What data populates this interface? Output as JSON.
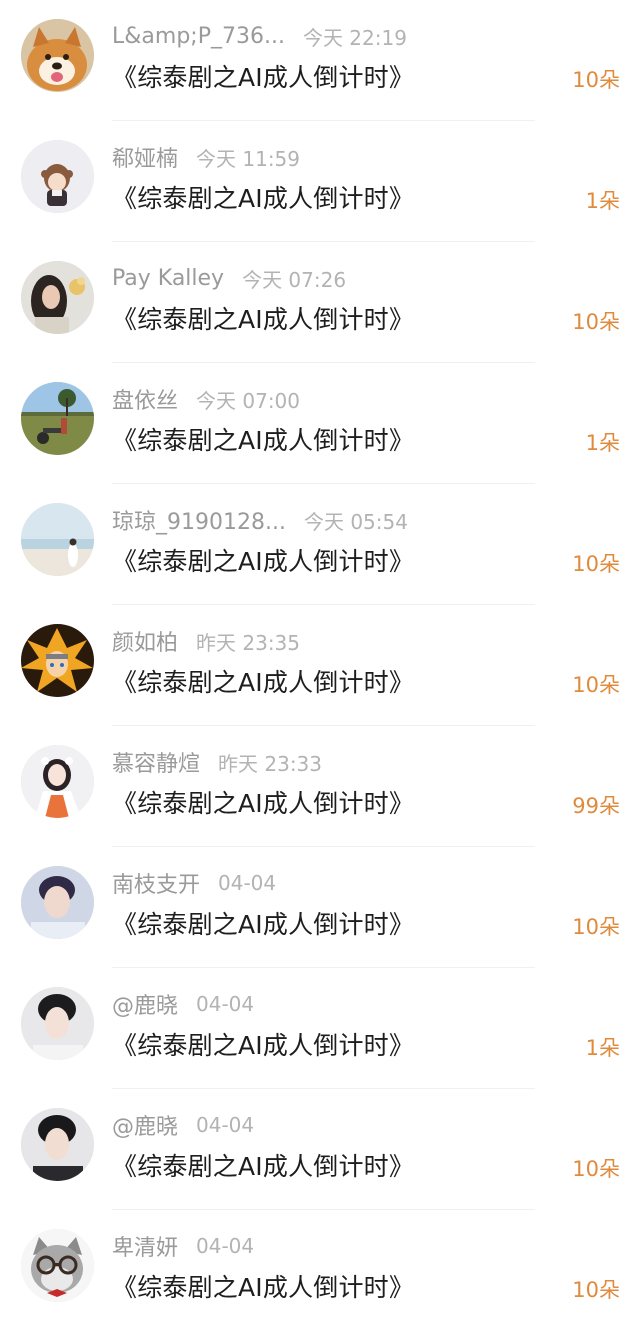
{
  "records": [
    {
      "name": "L&amp;P_736...",
      "time": "今天 22:19",
      "gift": "《综泰剧之AI成人倒计时》",
      "count": "10朵",
      "avatar": "shiba-dog-avatar"
    },
    {
      "name": "郗娅楠",
      "time": "今天 11:59",
      "gift": "《综泰剧之AI成人倒计时》",
      "count": "1朵",
      "avatar": "anime-girl-avatar"
    },
    {
      "name": "Pay Kalley",
      "time": "今天 07:26",
      "gift": "《综泰剧之AI成人倒计时》",
      "count": "10朵",
      "avatar": "woman-portrait-avatar"
    },
    {
      "name": "盘依丝",
      "time": "今天 07:00",
      "gift": "《综泰剧之AI成人倒计时》",
      "count": "1朵",
      "avatar": "grassland-scooter-avatar"
    },
    {
      "name": "琼琼_9190128...",
      "time": "今天 05:54",
      "gift": "《综泰剧之AI成人倒计时》",
      "count": "10朵",
      "avatar": "beach-figure-avatar"
    },
    {
      "name": "颜如柏",
      "time": "昨天 23:35",
      "gift": "《综泰剧之AI成人倒计时》",
      "count": "10朵",
      "avatar": "anime-character-avatar"
    },
    {
      "name": "慕容静煊",
      "time": "昨天 23:33",
      "gift": "《综泰剧之AI成人倒计时》",
      "count": "99朵",
      "avatar": "costume-girl-avatar"
    },
    {
      "name": "南枝支开",
      "time": "04-04",
      "gift": "《综泰剧之AI成人倒计时》",
      "count": "10朵",
      "avatar": "man-portrait-avatar"
    },
    {
      "name": "@鹿晓",
      "time": "04-04",
      "gift": "《综泰剧之AI成人倒计时》",
      "count": "1朵",
      "avatar": "man-portrait-avatar"
    },
    {
      "name": "@鹿晓",
      "time": "04-04",
      "gift": "《综泰剧之AI成人倒计时》",
      "count": "10朵",
      "avatar": "man-portrait-avatar"
    },
    {
      "name": "卑清妍",
      "time": "04-04",
      "gift": "《综泰剧之AI成人倒计时》",
      "count": "10朵",
      "avatar": "glasses-cat-avatar"
    }
  ],
  "colors": {
    "name": "#9a9a9a",
    "time": "#b3b3b3",
    "title": "#1e1e1e",
    "count": "#e08a3c",
    "divider": "#f0f0f0"
  }
}
